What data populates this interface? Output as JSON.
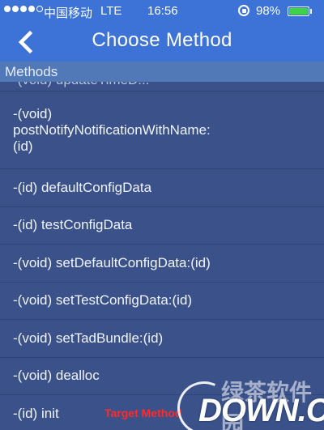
{
  "status_bar": {
    "carrier": "中国移动",
    "network": "LTE",
    "time": "16:56",
    "battery_percent": "98%",
    "battery_level": 0.98,
    "signal_bars_filled": 4,
    "signal_bars_total": 5
  },
  "nav": {
    "title": "Choose Method"
  },
  "section": {
    "header": "Methods"
  },
  "methods": [
    {
      "label": "-(void) updateTimeD..."
    },
    {
      "label": "-(void)\npostNotifyNotificationWithName:\n(id)"
    },
    {
      "label": "-(id) defaultConfigData"
    },
    {
      "label": "-(id) testConfigData"
    },
    {
      "label": "-(void) setDefaultConfigData:(id)"
    },
    {
      "label": "-(void) setTestConfigData:(id)"
    },
    {
      "label": "-(void) setTadBundle:(id)"
    },
    {
      "label": "-(void) dealloc"
    },
    {
      "label": "-(id) init"
    }
  ],
  "overlay": {
    "target_label": "Target Method",
    "watermark_text": "DOWN.CC",
    "watermark_cn": "绿茶软件园"
  },
  "colors": {
    "nav_bg": "#3d73d6",
    "list_bg": "#3a5189",
    "section_bg": "#5179b8",
    "battery_fill": "#3ed24a",
    "target_label": "#ff2a2a"
  }
}
